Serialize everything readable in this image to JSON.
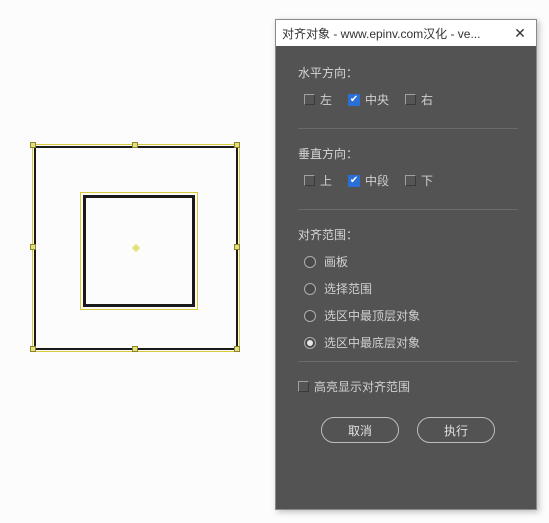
{
  "dialog": {
    "title": "对齐对象 - www.epinv.com汉化 - ve...",
    "horizontal": {
      "label": "水平方向：",
      "left": "左",
      "center": "中央",
      "right": "右",
      "selected": "center"
    },
    "vertical": {
      "label": "垂直方向：",
      "top": "上",
      "middle": "中段",
      "bottom": "下",
      "selected": "middle"
    },
    "scope": {
      "label": "对齐范围：",
      "artboard": "画板",
      "selection": "选择范围",
      "topmost": "选区中最顶层对象",
      "bottommost": "选区中最底层对象",
      "selected": "bottommost"
    },
    "highlight": {
      "label": "高亮显示对齐范围",
      "checked": false
    },
    "buttons": {
      "cancel": "取消",
      "execute": "执行"
    }
  }
}
